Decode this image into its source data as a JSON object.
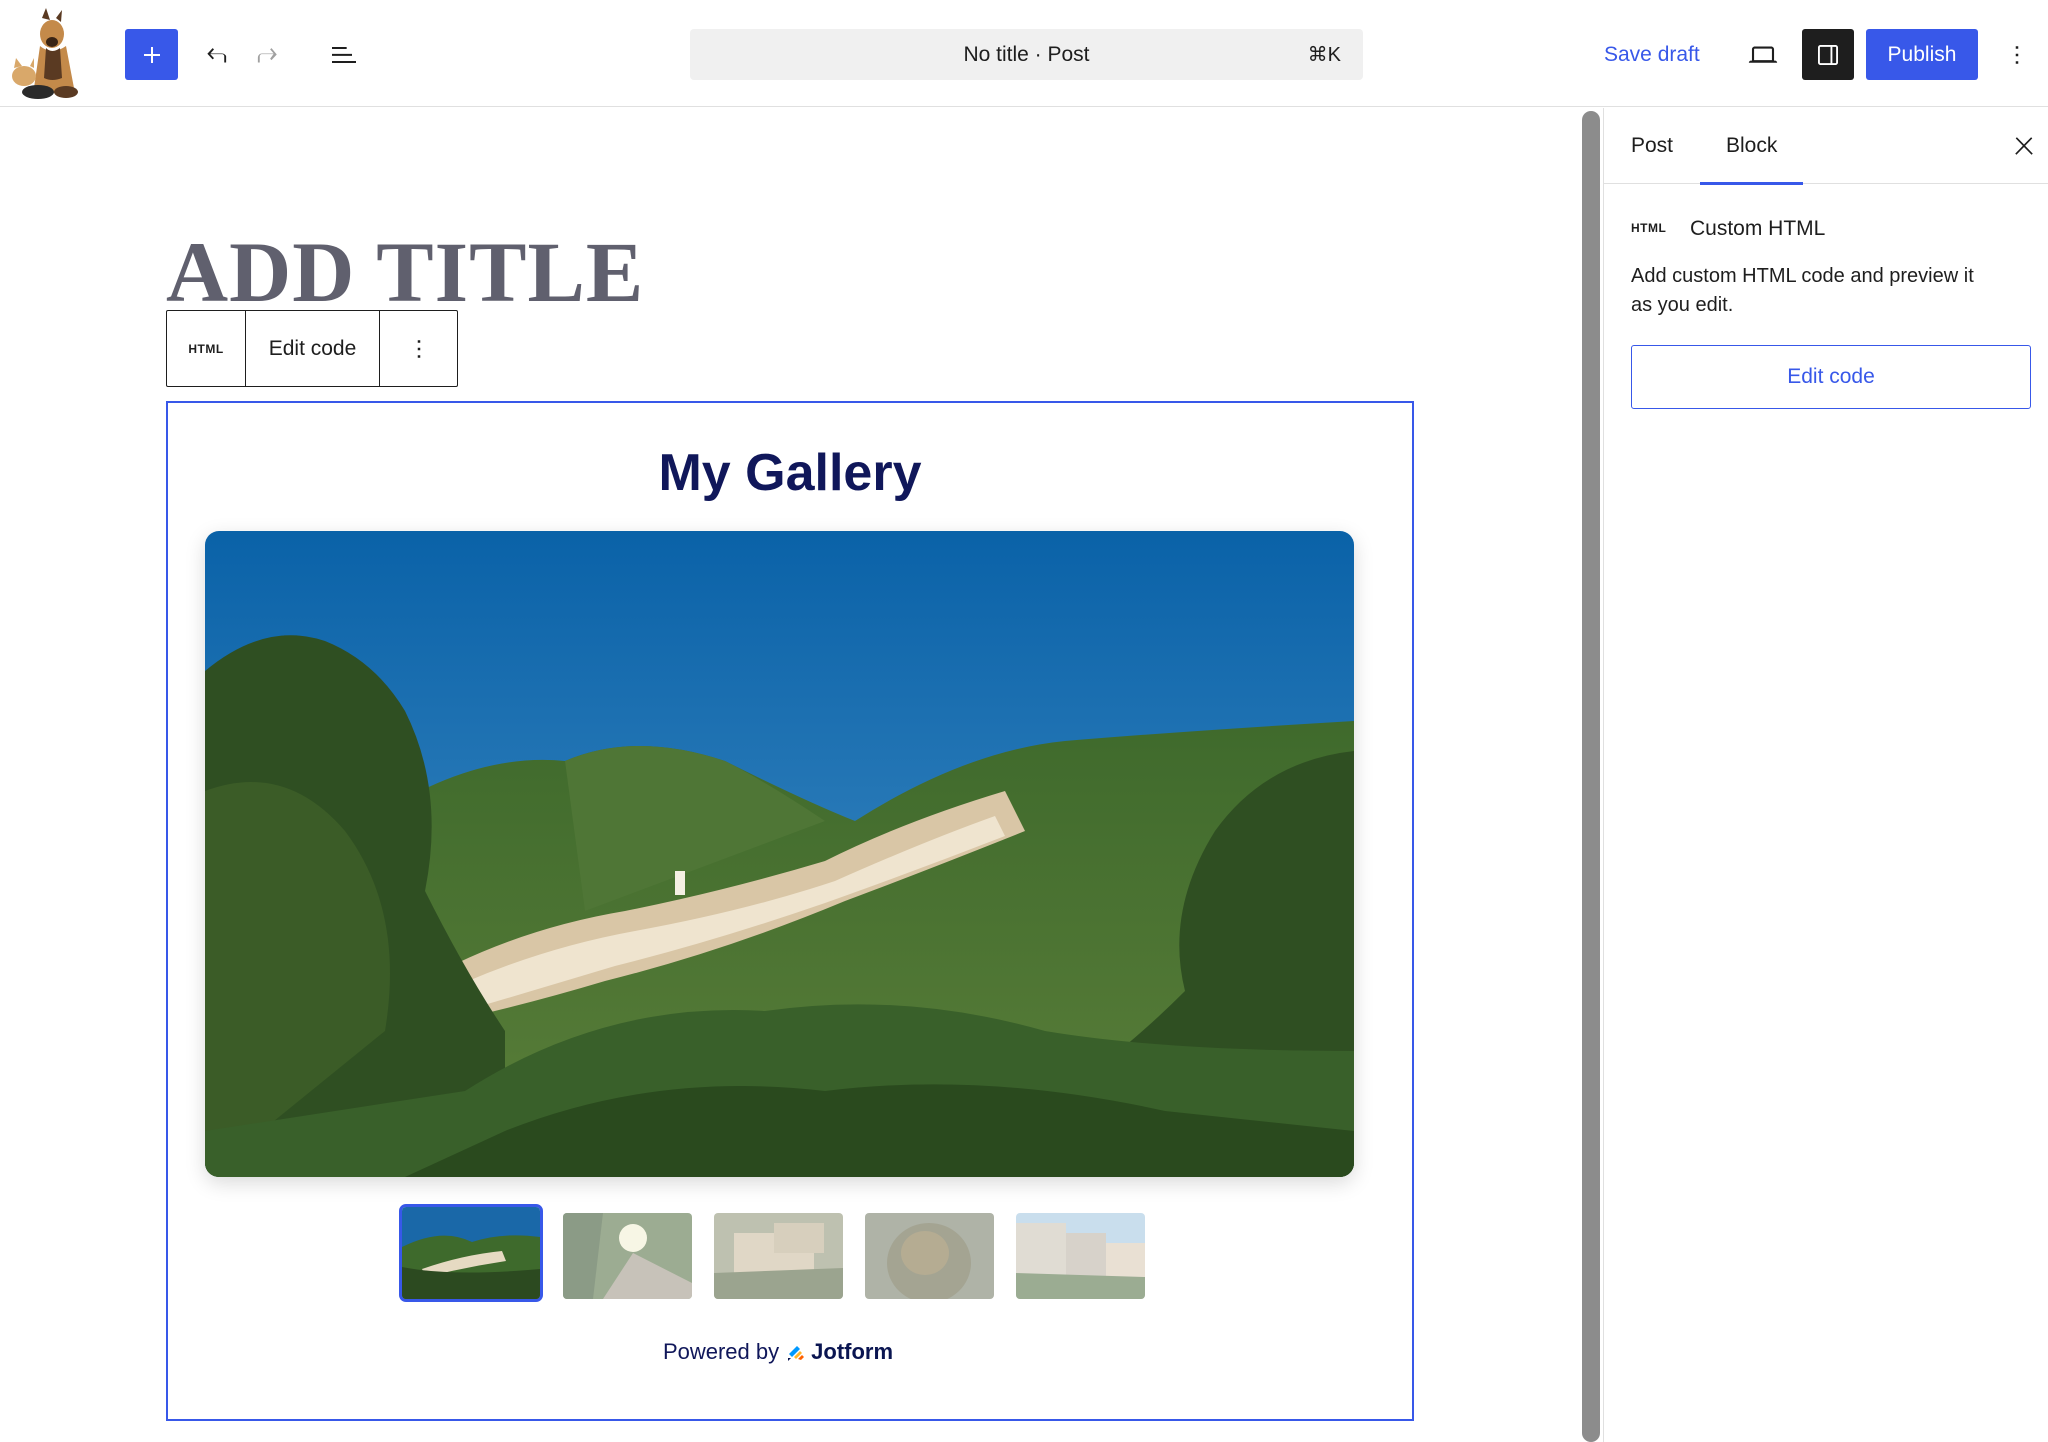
{
  "header": {
    "command_bar": {
      "title": "No title · Post",
      "shortcut": "⌘K"
    },
    "save_draft_label": "Save draft",
    "publish_label": "Publish",
    "icons": {
      "inserter": "plus-icon",
      "undo": "undo-icon",
      "redo": "redo-icon",
      "document_overview": "list-view-icon",
      "preview": "desktop-preview-icon",
      "settings": "sidebar-settings-icon",
      "options": "more-vertical-icon"
    }
  },
  "editor": {
    "title_placeholder": "ADD TITLE",
    "block_toolbar": {
      "block_type_label": "HTML",
      "edit_code_label": "Edit code"
    },
    "gallery": {
      "title": "My Gallery",
      "thumbnail_count": 5,
      "active_thumbnail": 1,
      "powered_by_label": "Powered by",
      "powered_by_brand": "Jotform"
    }
  },
  "sidebar": {
    "tabs": [
      {
        "label": "Post",
        "active": false
      },
      {
        "label": "Block",
        "active": true
      }
    ],
    "block_card": {
      "icon_label": "HTML",
      "title": "Custom HTML",
      "description": "Add custom HTML code and preview it as you edit."
    },
    "edit_code_label": "Edit code"
  },
  "colors": {
    "accent": "#3858e9",
    "dark": "#1e1e1e",
    "gallery_title": "#10175a",
    "title_placeholder": "#60606e"
  }
}
